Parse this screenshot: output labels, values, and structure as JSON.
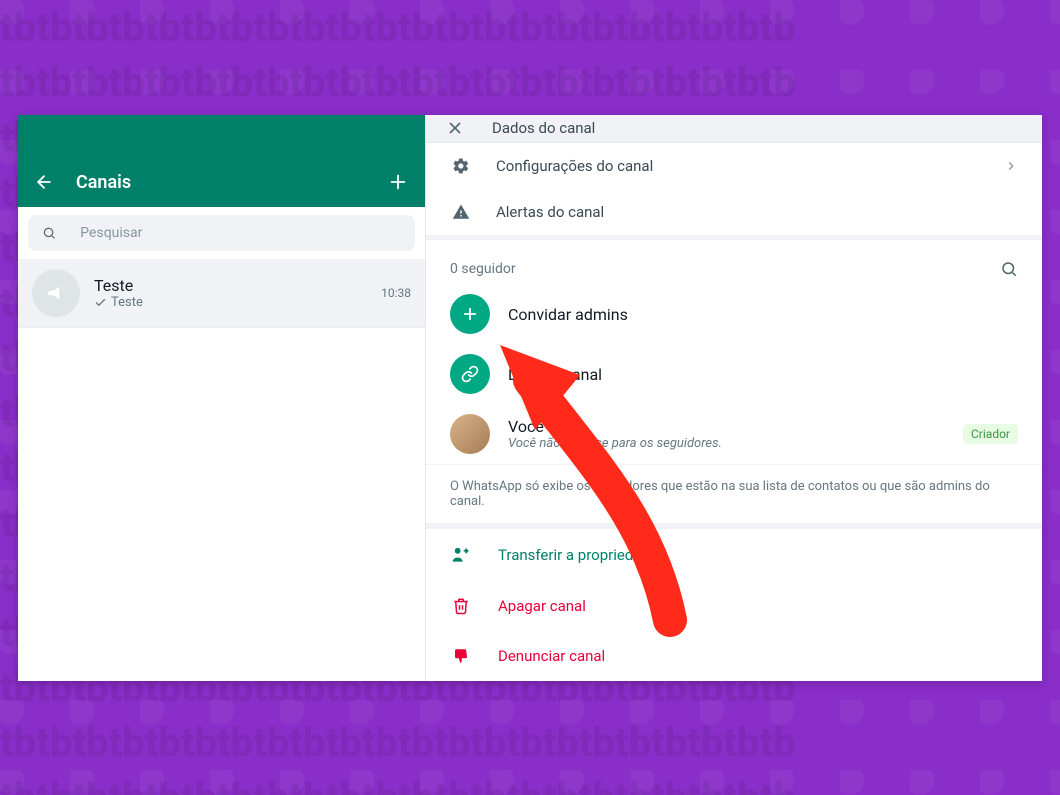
{
  "sidebar": {
    "title": "Canais",
    "search_placeholder": "Pesquisar",
    "channel": {
      "name": "Teste",
      "subtitle": "Teste",
      "time": "10:38"
    }
  },
  "panel": {
    "header_title": "Dados do canal",
    "settings_label": "Configurações do canal",
    "alerts_label": "Alertas do canal",
    "followers_count": "0 seguidor",
    "invite_admins_label": "Convidar admins",
    "channel_link_label": "Link do canal",
    "member": {
      "name": "Você",
      "subtitle": "Você não aparece para os seguidores.",
      "badge": "Criador"
    },
    "note": "O WhatsApp só exibe os seguidores que estão na sua lista de contatos ou que são admins do canal.",
    "transfer_label": "Transferir a propriedade",
    "delete_label": "Apagar canal",
    "report_label": "Denunciar canal"
  }
}
